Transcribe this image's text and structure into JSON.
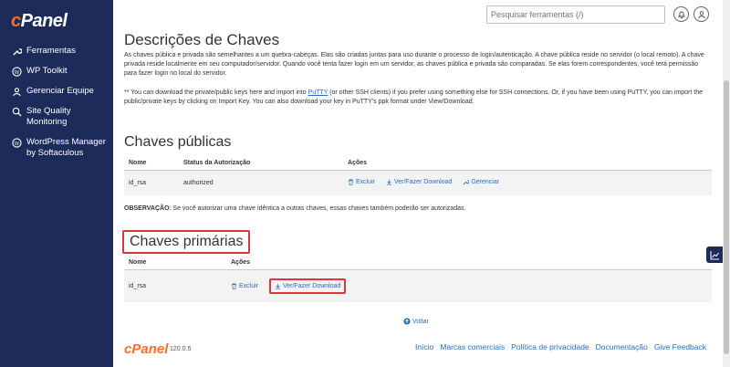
{
  "app": {
    "logo": "cPanel"
  },
  "sidebar": {
    "items": [
      {
        "label": "Ferramentas",
        "icon": "wrench-icon"
      },
      {
        "label": "WP Toolkit",
        "icon": "wordpress-icon"
      },
      {
        "label": "Gerenciar Equipe",
        "icon": "users-icon"
      },
      {
        "label": "Site Quality Monitoring",
        "icon": "monitor-icon"
      },
      {
        "label": "WordPress Manager by Softaculous",
        "icon": "wordpress-icon"
      }
    ]
  },
  "header": {
    "search_placeholder": "Pesquisar ferramentas (/)"
  },
  "main": {
    "title": "Descrições de Chaves",
    "description": "As chaves pública e privada são semelhantes a um quebra-cabeças. Elas são criadas juntas para uso durante o processo de login/autenticação. A chave pública reside no servidor (o local remoto). A chave privada reside localmente em seu computador/servidor. Quando você tenta fazer login em um servidor, as chaves pública e privada são comparadas. Se elas forem correspondentes, você terá permissão para fazer login no local do servidor.",
    "note_pre": "** You can download the private/public keys here and import into ",
    "note_link": "PuTTY",
    "note_post": " (or other SSH clients) if you prefer using something else for SSH connections. Or, if you have been using PuTTY, you can import the public/private keys by clicking on Import Key. You can also download your key in PuTTY's ppk format under View/Download.",
    "public": {
      "heading": "Chaves públicas",
      "col_name": "Nome",
      "col_status": "Status da Autorização",
      "col_actions": "Ações",
      "row": {
        "name": "id_rsa",
        "status": "authorized"
      },
      "action_delete": "Excluir",
      "action_view": "Ver/Fazer Download",
      "action_manage": "Gerenciar"
    },
    "observation_label": "OBSERVAÇÃO",
    "observation_text": ": Se você autorizar uma chave idêntica a outras chaves, essas chaves também poderão ser autorizadas.",
    "private": {
      "heading": "Chaves primárias",
      "col_name": "Nome",
      "col_actions": "Ações",
      "row": {
        "name": "id_rsa"
      },
      "action_delete": "Excluir",
      "action_view": "Ver/Fazer Download"
    },
    "back_label": "Voltar"
  },
  "footer": {
    "logo": "cPanel",
    "version": "120.0.5",
    "links": [
      "Início",
      "Marcas comerciais",
      "Política de privacidade",
      "Documentação",
      "Give Feedback"
    ]
  },
  "colors": {
    "sidebar": "#1d2b5a",
    "accent": "#ff6c2c",
    "link": "#2a6ebb",
    "highlight": "#d9363e"
  }
}
